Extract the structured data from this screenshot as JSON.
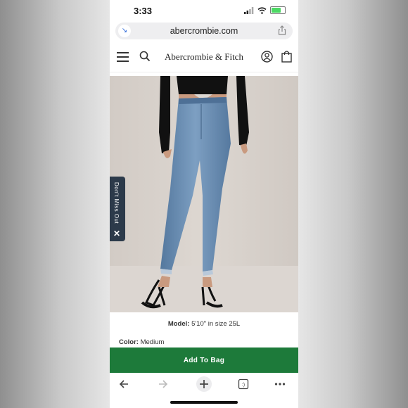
{
  "status_bar": {
    "time": "3:33"
  },
  "browser": {
    "url": "abercrombie.com"
  },
  "site": {
    "logo": "Abercrombie & Fitch"
  },
  "promo": {
    "tab_label": "Don't Miss Out"
  },
  "product": {
    "model_label": "Model:",
    "model_value": "5'10\" in size 25L",
    "color_label": "Color:",
    "color_value": "Medium",
    "add_to_bag": "Add To Bag"
  },
  "icons": [
    "signal-icon",
    "wifi-icon",
    "battery-icon",
    "reload-icon",
    "share-icon",
    "hamburger-icon",
    "search-icon",
    "account-icon",
    "bag-icon",
    "close-icon",
    "back-icon",
    "forward-icon",
    "new-tab-icon",
    "tabs-icon",
    "more-icon"
  ],
  "colors": {
    "accent_green": "#1d7a3a",
    "promo_tab": "#2c3a4a",
    "hero_bg": "#d8d2cc"
  }
}
